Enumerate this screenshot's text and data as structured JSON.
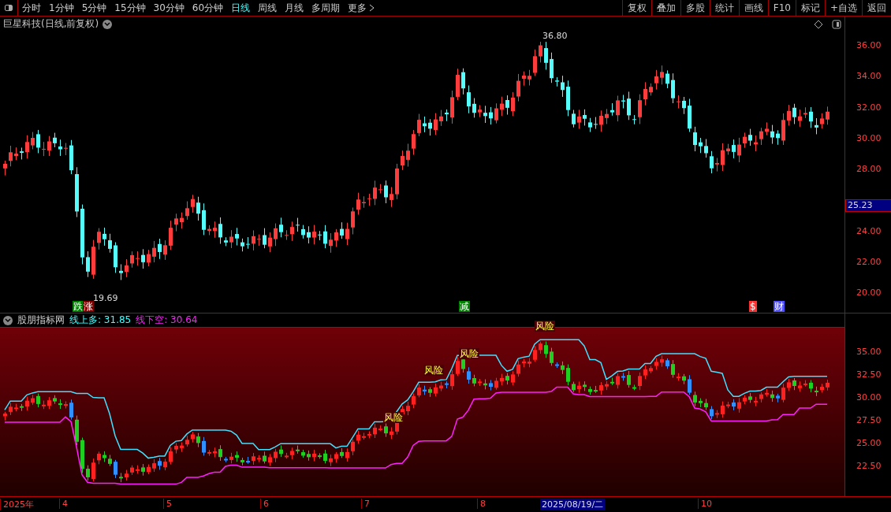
{
  "toolbar": {
    "periods": [
      {
        "label": "分时",
        "selected": false
      },
      {
        "label": "1分钟",
        "selected": false
      },
      {
        "label": "5分钟",
        "selected": false
      },
      {
        "label": "15分钟",
        "selected": false
      },
      {
        "label": "30分钟",
        "selected": false
      },
      {
        "label": "60分钟",
        "selected": false
      },
      {
        "label": "日线",
        "selected": true
      },
      {
        "label": "周线",
        "selected": false
      },
      {
        "label": "月线",
        "selected": false
      },
      {
        "label": "多周期",
        "selected": false
      }
    ],
    "more": "更多",
    "actions": [
      "复权",
      "叠加",
      "多股",
      "统计",
      "画线",
      "F10",
      "标记",
      "+自选",
      "返回"
    ]
  },
  "main_chart": {
    "title": "巨星科技(日线,前复权)",
    "price_ticks": [
      "36.00",
      "34.00",
      "32.00",
      "30.00",
      "28.00",
      "24.00",
      "22.00",
      "20.00"
    ],
    "current_price": "25.23",
    "high_label": "36.80",
    "low_label": "19.69",
    "signals": [
      {
        "text": "跌",
        "color": "#008000"
      },
      {
        "text": "涨",
        "color": "#800000"
      },
      {
        "text": "减",
        "color": "#008000"
      },
      {
        "text": "$",
        "color": "#ff3030"
      },
      {
        "text": "财",
        "color": "#5050ff"
      }
    ]
  },
  "indicator": {
    "name": "股朋指标网",
    "readings": [
      {
        "label": "线上多: 31.85",
        "color": "#40ffff"
      },
      {
        "label": "线下空: 30.64",
        "color": "#ff20ff"
      }
    ],
    "price_ticks": [
      "35.00",
      "32.50",
      "30.00",
      "27.50",
      "25.00",
      "22.50"
    ],
    "risk_labels": [
      "风险",
      "风险",
      "风险",
      "风险"
    ]
  },
  "date_axis": {
    "labels": [
      "2025年",
      "4",
      "5",
      "6",
      "7",
      "8",
      "10"
    ],
    "cursor_date": "2025/08/19/二"
  }
}
